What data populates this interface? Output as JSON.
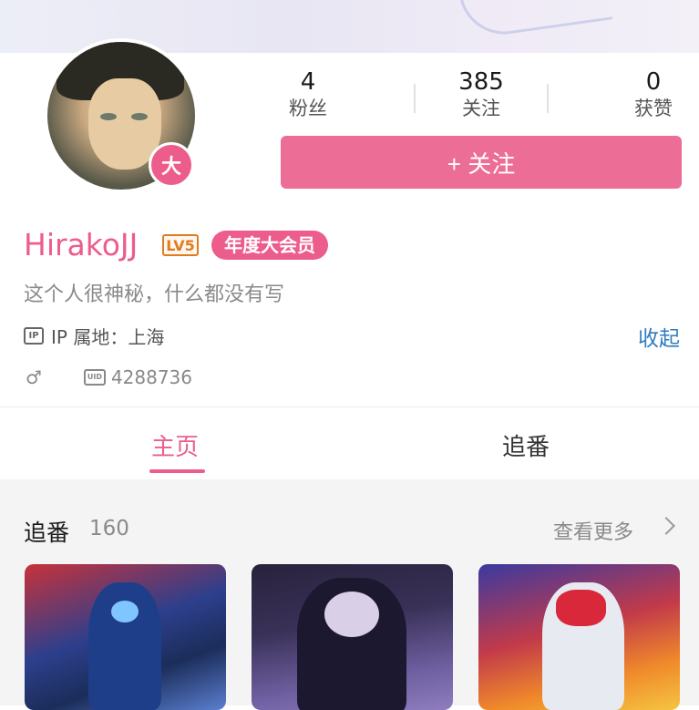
{
  "profile": {
    "username": "HirakoJJ",
    "level": "LV5",
    "vip_label": "年度大会员",
    "badge_char": "大",
    "bio": "这个人很神秘，什么都没有写",
    "ip_icon_text": "IP",
    "ip_location": "IP 属地：上海",
    "collapse_label": "收起",
    "gender_symbol": "♂",
    "uid_icon_text": "UID",
    "uid": "4288736"
  },
  "stats": [
    {
      "value": "4",
      "label": "粉丝"
    },
    {
      "value": "385",
      "label": "关注"
    },
    {
      "value": "0",
      "label": "获赞"
    }
  ],
  "follow_button": "+ 关注",
  "tabs": [
    {
      "label": "主页",
      "active": true
    },
    {
      "label": "追番",
      "active": false
    }
  ],
  "bangumi_section": {
    "title": "追番",
    "count": "160",
    "see_more": "查看更多"
  },
  "colors": {
    "accent": "#ec5d8c",
    "follow_button": "#ec6d95",
    "link": "#2f7bc4",
    "level": "#e07b1e"
  },
  "icons": [
    "chevron-right-icon",
    "ip-icon",
    "uid-icon",
    "male-icon",
    "verified-badge-icon"
  ]
}
